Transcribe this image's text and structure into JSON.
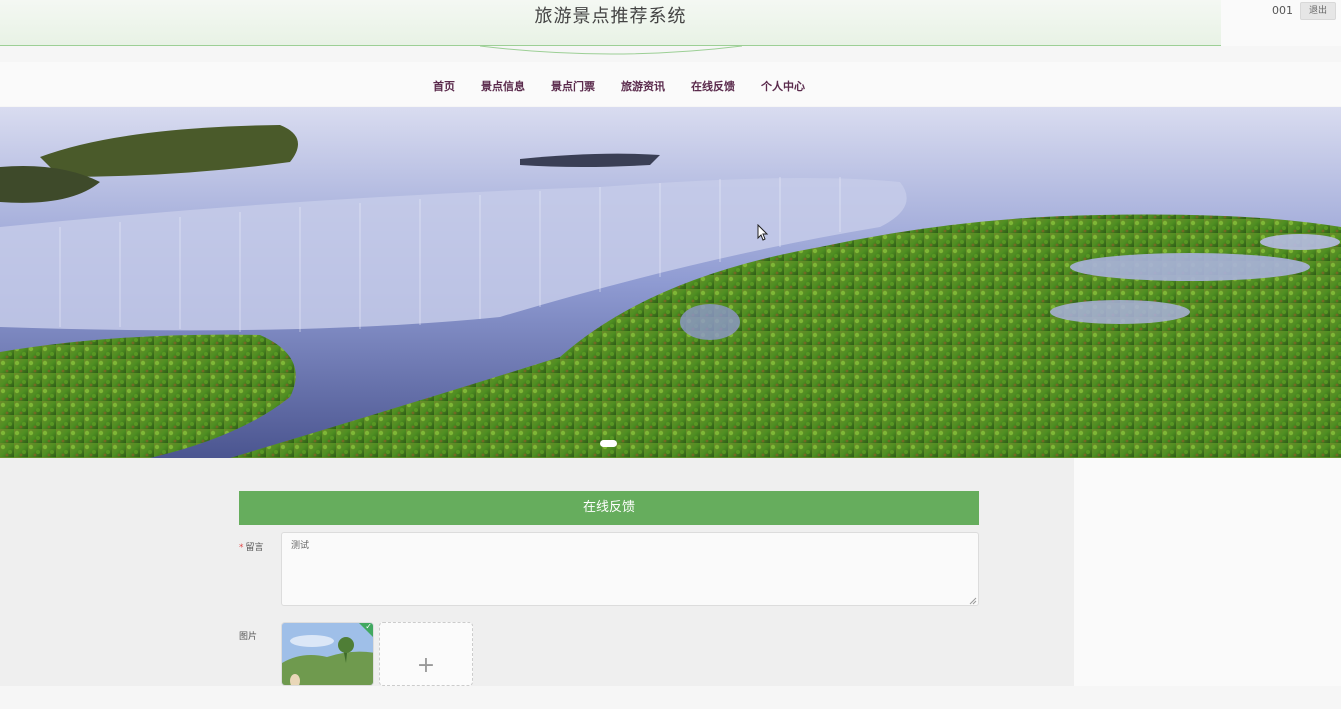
{
  "header": {
    "title": "旅游景点推荐系统",
    "username": "001",
    "logout_label": "退出"
  },
  "nav": {
    "items": [
      {
        "label": "首页"
      },
      {
        "label": "景点信息"
      },
      {
        "label": "景点门票"
      },
      {
        "label": "旅游资讯"
      },
      {
        "label": "在线反馈"
      },
      {
        "label": "个人中心"
      }
    ],
    "active": "在线反馈"
  },
  "banner": {
    "image": "seascape-waterfall-mossy-rocks",
    "indicator_count": 1
  },
  "form": {
    "section_title": "在线反馈",
    "message_label": "留言",
    "message_required_mark": "*",
    "message_value": "测试",
    "image_label": "图片",
    "upload_icon": "plus-icon",
    "uploaded_check_icon": "check-icon"
  },
  "colors": {
    "accent": "#66ad5d",
    "nav_text": "#5a2a4c",
    "success": "#41a85f"
  }
}
